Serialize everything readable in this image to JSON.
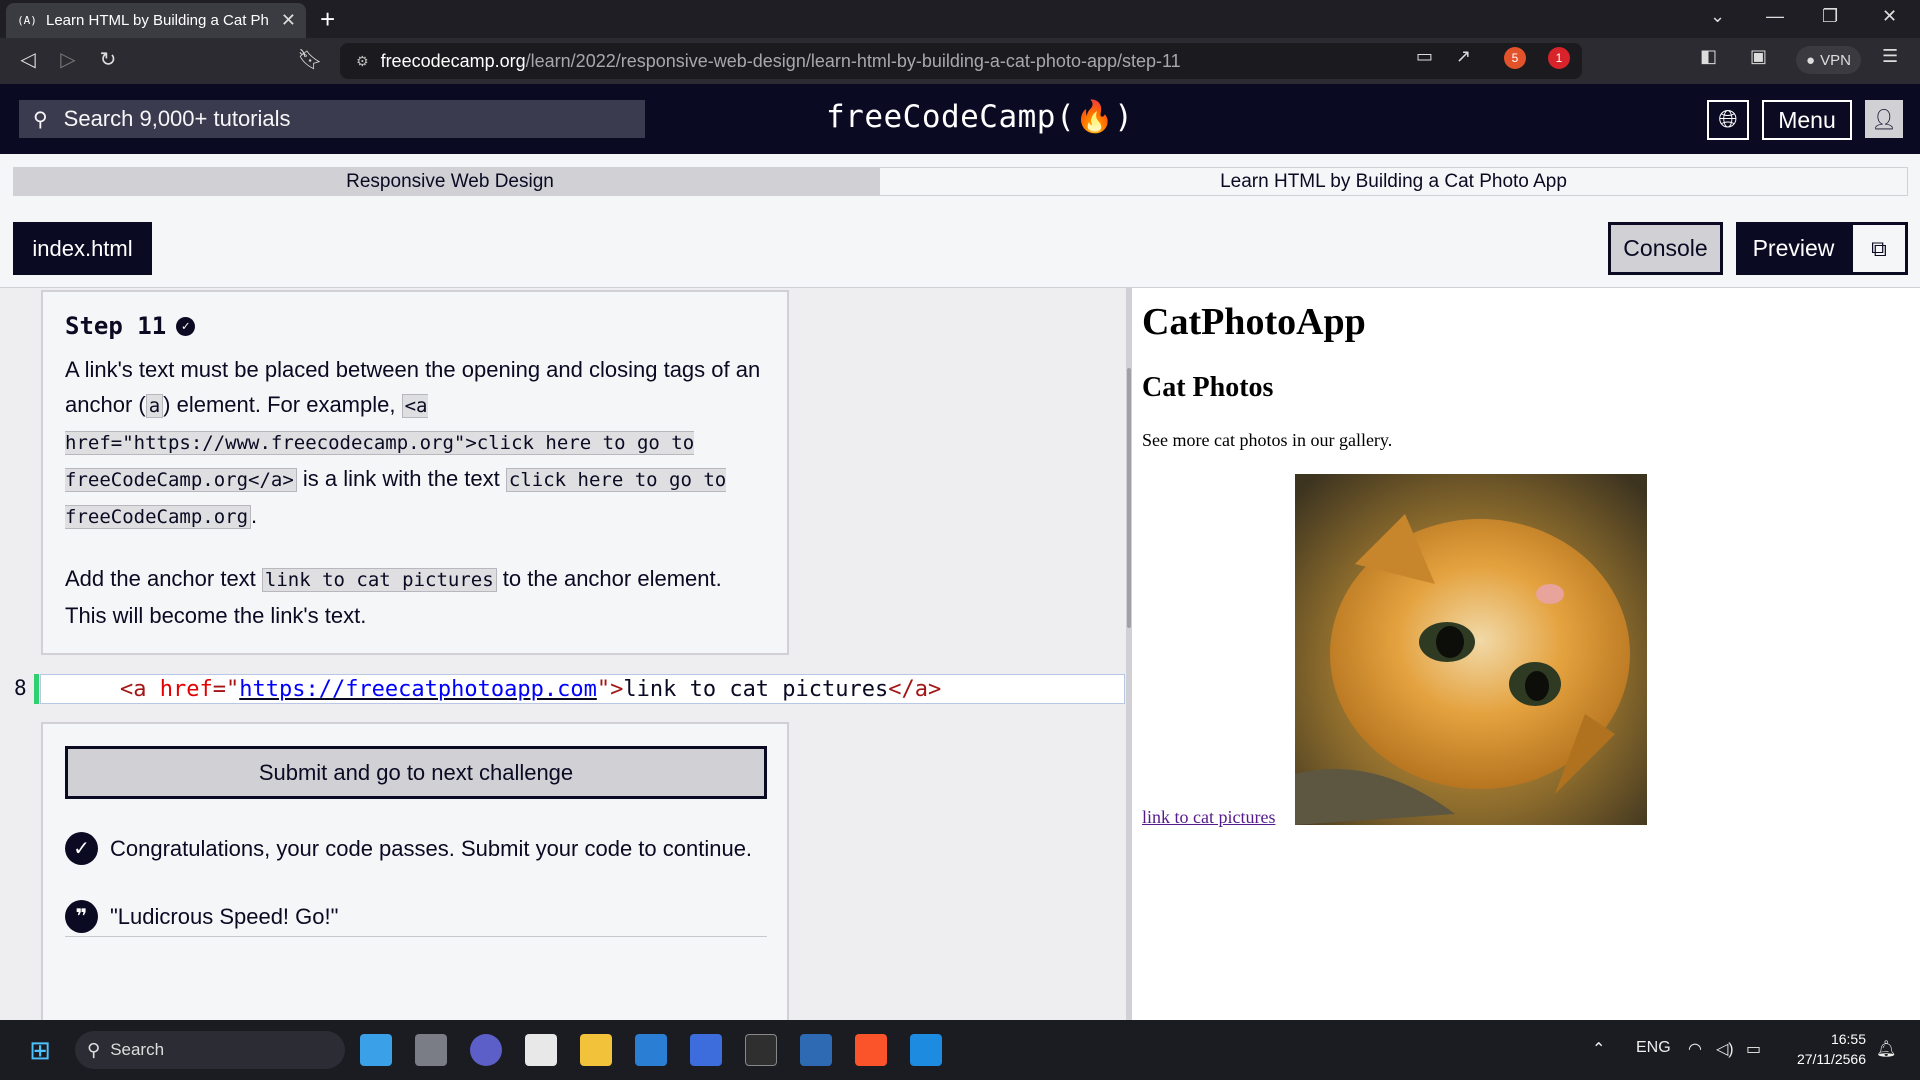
{
  "browser": {
    "tab_title": "Learn HTML by Building a Cat Ph",
    "tab_favicon": "(A)",
    "url_host": "freecodecamp.org",
    "url_path": "/learn/2022/responsive-web-design/learn-html-by-building-a-cat-photo-app/step-11",
    "vpn_label": "VPN",
    "shield_count": "5",
    "alert_count": "1"
  },
  "header": {
    "search_placeholder": "Search 9,000+ tutorials",
    "logo_text": "freeCodeCamp(🔥)",
    "menu_label": "Menu"
  },
  "breadcrumb": {
    "superblock": "Responsive Web Design",
    "block": "Learn HTML by Building a Cat Photo App"
  },
  "toolbar": {
    "file_tab": "index.html",
    "console_label": "Console",
    "preview_label": "Preview"
  },
  "instructions": {
    "step_title": "Step 11",
    "p1_a": "A link's text must be placed between the opening and closing tags of an anchor (",
    "p1_code_a": "a",
    "p1_b": ") element. For example, ",
    "p1_code_example": "<a href=\"https://www.freecodecamp.org\">click here to go to freeCodeCamp.org</a>",
    "p1_c": " is a link with the text ",
    "p1_code_text": "click here to go to freeCodeCamp.org",
    "p1_d": ".",
    "p2_a": "Add the anchor text ",
    "p2_code": "link to cat pictures",
    "p2_b": " to the anchor element. This will become the link's text."
  },
  "editor": {
    "line_number": "8",
    "tag_open": "<a",
    "attr_name": "href",
    "attr_eq": "=\"",
    "attr_value": "https://freecatphotoapp.com",
    "attr_close": "\">",
    "link_text": "link to cat pictures",
    "tag_close": "</a>"
  },
  "results": {
    "submit_label": "Submit and go to next challenge",
    "success_message": "Congratulations, your code passes. Submit your code to continue.",
    "quote": "\"Ludicrous Speed! Go!\""
  },
  "preview": {
    "h1": "CatPhotoApp",
    "h2": "Cat Photos",
    "gallery_text": "See more cat photos in our gallery.",
    "link_text": "link to cat pictures"
  },
  "taskbar": {
    "search_label": "Search",
    "language": "ENG",
    "time": "16:55",
    "date": "27/11/2566"
  },
  "colors": {
    "fcc_dark": "#0a0a23",
    "fcc_gray": "#d0d0d5",
    "success_bar": "#2ed16e"
  }
}
